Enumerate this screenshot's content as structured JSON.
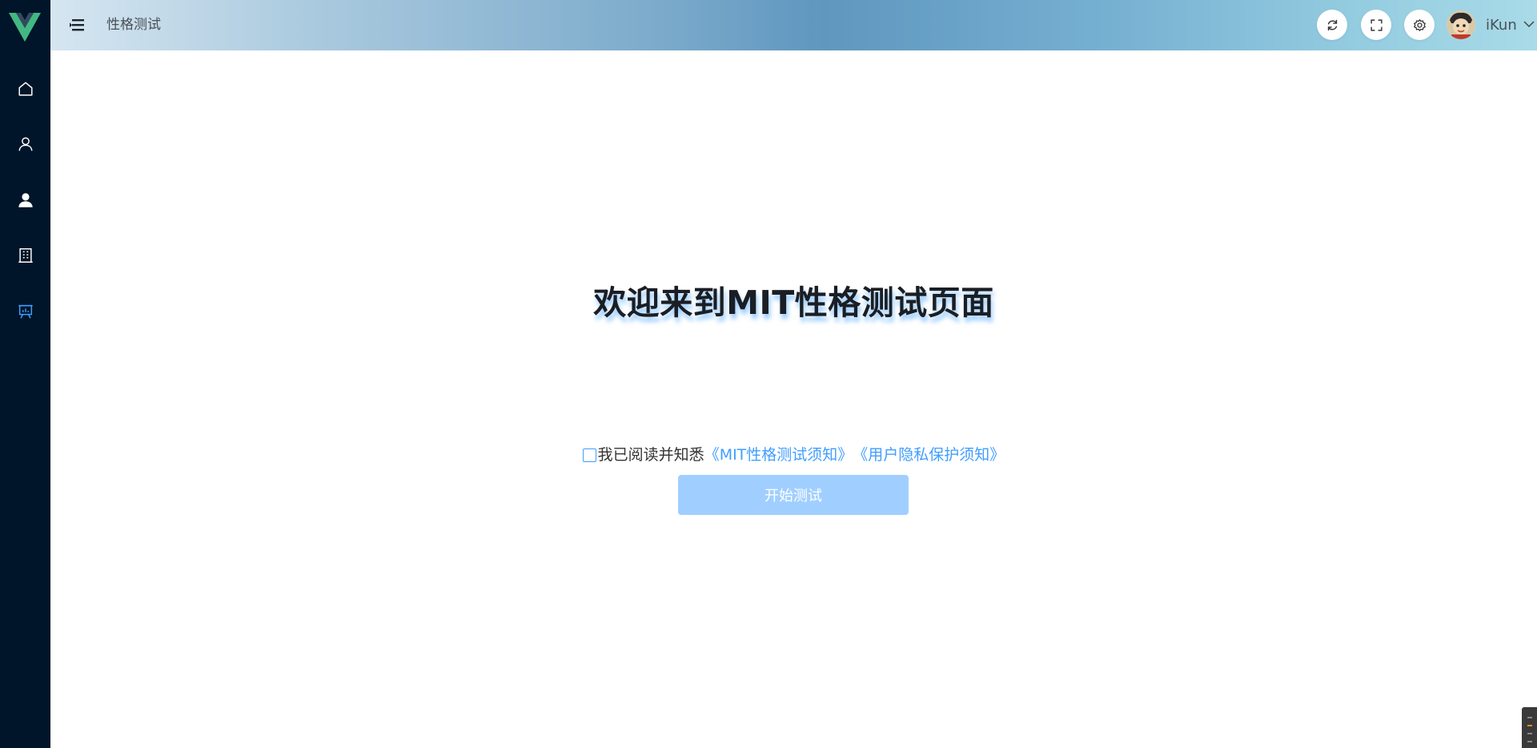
{
  "app": {
    "brand_color": "#42b883",
    "sidebar_bg": "#001529",
    "accent": "#409eff"
  },
  "sidebar": {
    "items": [
      {
        "icon": "home-icon",
        "active": false
      },
      {
        "icon": "user-icon",
        "active": false
      },
      {
        "icon": "user-filled-icon",
        "active": false
      },
      {
        "icon": "office-building-icon",
        "active": false
      },
      {
        "icon": "data-board-icon",
        "active": true
      }
    ]
  },
  "header": {
    "page_title": "性格测试",
    "buttons": [
      "refresh-icon",
      "fullscreen-icon",
      "settings-icon"
    ],
    "username": "iKun"
  },
  "main": {
    "title": "欢迎来到MIT性格测试页面",
    "agreement": {
      "checked": false,
      "text": "我已阅读并知悉",
      "link1": "《MIT性格测试须知》",
      "link2": "《用户隐私保护须知》"
    },
    "start_button": "开始测试"
  }
}
